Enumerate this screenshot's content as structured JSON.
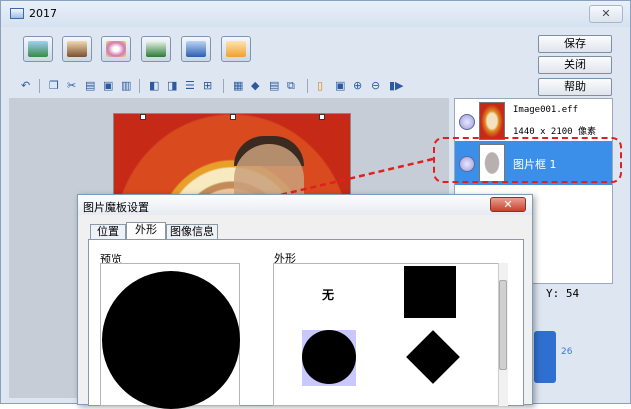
{
  "window": {
    "title": "2017",
    "close_glyph": "✕"
  },
  "toolbar": {
    "buttons": [
      {
        "name": "background-tool-button",
        "icon": "background-icon",
        "color": "#3a8a4a"
      },
      {
        "name": "photo-tool-button",
        "icon": "photo-icon",
        "color": "#7a5030"
      },
      {
        "name": "decoration-tool-button",
        "icon": "decoration-icon",
        "color": "#d07ab0"
      },
      {
        "name": "text-tool-button",
        "icon": "text-icon",
        "color": "#2b7a3a"
      },
      {
        "name": "line-tool-button",
        "icon": "line-icon",
        "color": "#2c5eb0"
      },
      {
        "name": "pointer-tool-button",
        "icon": "pointer-icon",
        "color": "#f0a030"
      }
    ],
    "save_label": "保存",
    "close_label": "关闭",
    "help_label": "帮助"
  },
  "layers": {
    "items": [
      {
        "line1": "Image001.eff",
        "line2": "1440 x 2100 像素"
      },
      {
        "line1": "图片框  1"
      }
    ]
  },
  "coords": {
    "y_text": "Y: 54"
  },
  "ruler": {
    "value": "26"
  },
  "dialog": {
    "title": "图片魔板设置",
    "close_glyph": "✕",
    "tabs": [
      "位置",
      "外形",
      "图像信息"
    ],
    "preview_label": "预览",
    "shape_label": "外形",
    "none_option": "无"
  }
}
